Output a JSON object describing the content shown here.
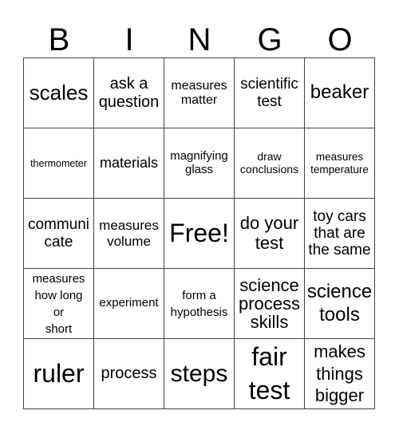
{
  "header": [
    "B",
    "I",
    "N",
    "G",
    "O"
  ],
  "rows": [
    [
      "scales",
      "ask a\nquestion",
      "measures\nmatter",
      "scientific\ntest",
      "beaker"
    ],
    [
      "thermometer",
      "materials",
      "magnifying\nglass",
      "draw\nconclusions",
      "measures\ntemperature"
    ],
    [
      "communi\ncate",
      "measures\nvolume",
      "Free!",
      "do your\ntest",
      "toy cars\nthat are\nthe same"
    ],
    [
      "measures\nhow long\nor\nshort",
      "experiment",
      "form a\nhypothesis",
      "science\nprocess\nskills",
      "science\ntools"
    ],
    [
      "ruler",
      "process",
      "steps",
      "fair\ntest",
      "makes\nthings\nbigger"
    ]
  ]
}
